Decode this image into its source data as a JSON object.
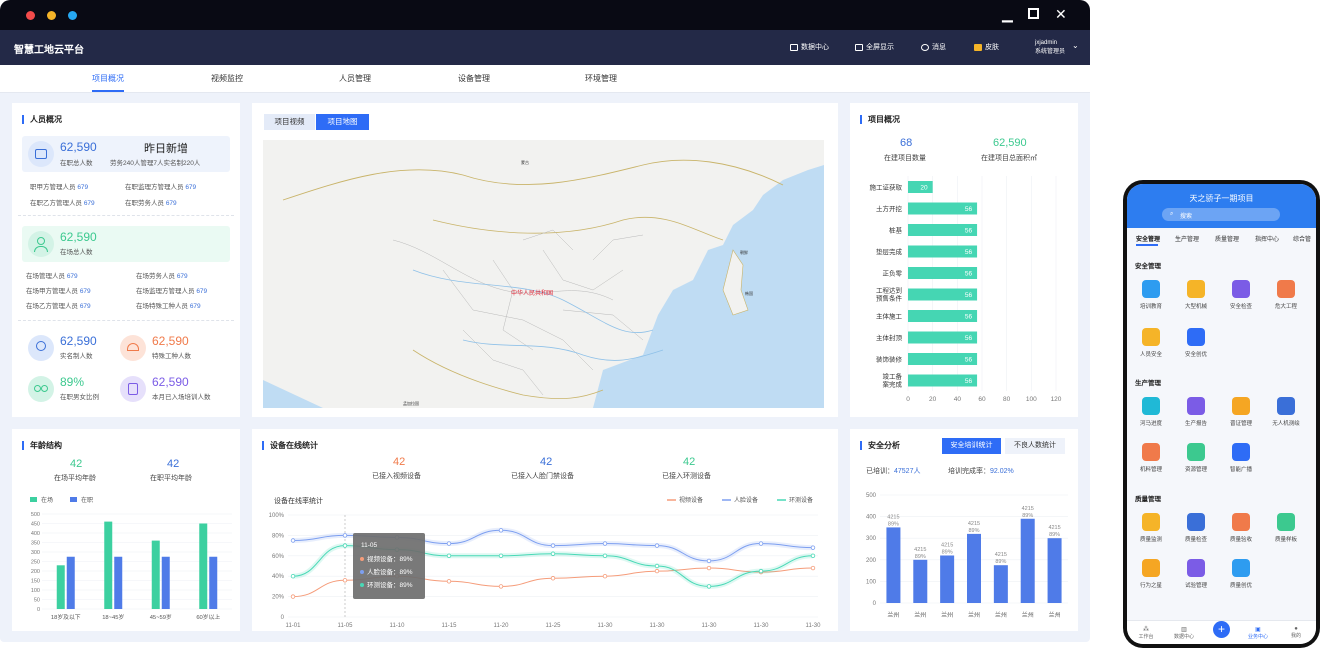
{
  "header": {
    "brand": "智慧工地云平台",
    "items": [
      "数据中心",
      "全屏显示",
      "消息",
      "皮肤"
    ],
    "username": "jxjadmin",
    "role": "系统管理员"
  },
  "nav": [
    "项目概况",
    "视频监控",
    "人员管理",
    "设备管理",
    "环境管理"
  ],
  "people": {
    "title": "人员概况",
    "total": "62,590",
    "total_label": "在职总人数",
    "yesterday_title": "昨日新增",
    "yesterday_desc": "劳务240人管理7人实名制220人",
    "rows1": [
      {
        "k": "职甲方管理人员",
        "v": "679"
      },
      {
        "k": "在职监理方管理人员",
        "v": "679"
      },
      {
        "k": "在职乙方管理人员",
        "v": "679"
      },
      {
        "k": "在职劳务人员",
        "v": "679"
      }
    ],
    "site_total": "62,590",
    "site_label": "在场总人数",
    "rows2": [
      {
        "k": "在场管理人员",
        "v": "679"
      },
      {
        "k": "在场劳务人员",
        "v": "679"
      },
      {
        "k": "在场甲方管理人员",
        "v": "679"
      },
      {
        "k": "在场监理方管理人员",
        "v": "679"
      },
      {
        "k": "在场乙方管理人员",
        "v": "679"
      },
      {
        "k": "在场特殊工种人员",
        "v": "679"
      }
    ],
    "stats": [
      {
        "v": "62,590",
        "l": "实名制人数"
      },
      {
        "v": "62,590",
        "l": "特殊工种人数"
      },
      {
        "v": "89%",
        "l": "在职男女比例"
      },
      {
        "v": "62,590",
        "l": "本月已入场培训人数"
      }
    ]
  },
  "map": {
    "tabs": [
      "项目视频",
      "项目地图"
    ],
    "labels": [
      "蒙古",
      "中华人民共和国",
      "朝鲜",
      "韩国",
      "孟加拉国"
    ]
  },
  "overview": {
    "title": "项目概况",
    "n1": "68",
    "l1": "在建项目数量",
    "n2": "62,590",
    "l2": "在建项目总面积㎡",
    "bars": [
      {
        "k": "施工证获取",
        "v": 20
      },
      {
        "k": "土方开挖",
        "v": 56
      },
      {
        "k": "桩基",
        "v": 56
      },
      {
        "k": "垫层完成",
        "v": 56
      },
      {
        "k": "正负零",
        "v": 56
      },
      {
        "k": "工程达到预售条件",
        "v": 56
      },
      {
        "k": "主体施工",
        "v": 56
      },
      {
        "k": "主体封顶",
        "v": 56
      },
      {
        "k": "装饰装修",
        "v": 56
      },
      {
        "k": "竣工备案完成",
        "v": 56
      }
    ],
    "ticks": [
      "0",
      "20",
      "40",
      "60",
      "80",
      "100",
      "120"
    ]
  },
  "age": {
    "title": "年龄结构",
    "n1": "42",
    "l1": "在场平均年龄",
    "n2": "42",
    "l2": "在职平均年龄",
    "legend": [
      "在场",
      "在职"
    ],
    "yticks": [
      "0",
      "50",
      "100",
      "150",
      "200",
      "250",
      "300",
      "350",
      "400",
      "450",
      "500"
    ],
    "categories": [
      "18岁及以下",
      "18~45岁",
      "45~59岁",
      "60岁以上"
    ],
    "series": [
      {
        "name": "在场",
        "values": [
          230,
          460,
          360,
          450
        ]
      },
      {
        "name": "在职",
        "values": [
          275,
          275,
          275,
          275
        ]
      }
    ]
  },
  "device": {
    "title": "设备在线统计",
    "stats": [
      {
        "v": "42",
        "l": "已接入视频设备"
      },
      {
        "v": "42",
        "l": "已接入人脸门禁设备"
      },
      {
        "v": "42",
        "l": "已接入环测设备"
      }
    ],
    "subtitle": "设备在线率统计",
    "legend": [
      "视频设备",
      "人脸设备",
      "环测设备"
    ],
    "yticks": [
      "0",
      "20%",
      "40%",
      "60%",
      "80%",
      "100%"
    ],
    "x": [
      "11-01",
      "11-05",
      "11-10",
      "11-15",
      "11-20",
      "11-25",
      "11-30",
      "11-30",
      "11-30",
      "11-30",
      "11-30"
    ],
    "series": [
      {
        "name": "视频设备",
        "values": [
          20,
          36,
          40,
          35,
          30,
          38,
          40,
          45,
          48,
          44,
          48
        ]
      },
      {
        "name": "人脸设备",
        "values": [
          75,
          80,
          78,
          72,
          85,
          70,
          72,
          70,
          55,
          72,
          68
        ]
      },
      {
        "name": "环测设备",
        "values": [
          40,
          70,
          66,
          60,
          60,
          62,
          60,
          50,
          30,
          45,
          60
        ]
      }
    ],
    "tooltip": {
      "date": "11-05",
      "rows": [
        "视频设备：89%",
        "人脸设备：89%",
        "环测设备：89%"
      ]
    }
  },
  "safety": {
    "title": "安全分析",
    "tabs": [
      "安全培训统计",
      "不良人数统计"
    ],
    "trained_label": "已培训：",
    "trained": "47527人",
    "rate_label": "培训完成率：",
    "rate": "92.02%",
    "yticks": [
      "0",
      "100",
      "200",
      "300",
      "400",
      "500"
    ],
    "categories": [
      "兰州",
      "兰州",
      "兰州",
      "兰州",
      "兰州",
      "兰州",
      "兰州"
    ],
    "values": [
      350,
      200,
      220,
      320,
      175,
      390,
      300
    ],
    "bar_label": "4215",
    "bar_pct": "89%"
  },
  "phone": {
    "title": "天之骄子一期项目",
    "search": "搜索",
    "tabs": [
      "安全管理",
      "生产管理",
      "质量管理",
      "指挥中心",
      "综合管"
    ],
    "sections": [
      {
        "name": "安全管理",
        "items": [
          "培训教育",
          "大型机械",
          "安全检查",
          "危大工程",
          "人员安全",
          "安全创优"
        ]
      },
      {
        "name": "生产管理",
        "items": [
          "河马进度",
          "生产报告",
          "晋证管理",
          "无人机测绘",
          "机料管理",
          "资源管理",
          "智能广播"
        ]
      },
      {
        "name": "质量管理",
        "items": [
          "质量监测",
          "质量检查",
          "质量验收",
          "质量样板",
          "行为之星",
          "试验管理",
          "质量创优"
        ]
      }
    ],
    "bottom": [
      "工作台",
      "数据中心",
      "",
      "业务中心",
      "我的"
    ]
  }
}
